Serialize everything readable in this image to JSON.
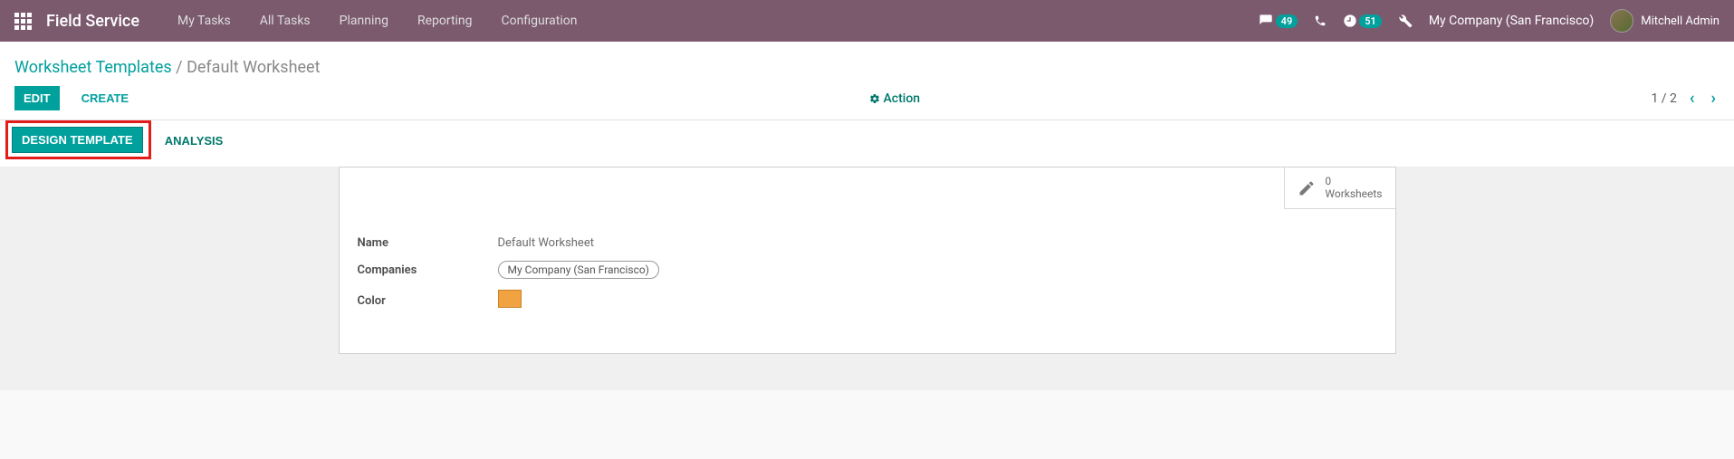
{
  "nav": {
    "brand": "Field Service",
    "items": [
      "My Tasks",
      "All Tasks",
      "Planning",
      "Reporting",
      "Configuration"
    ],
    "messages_badge": "49",
    "activities_badge": "51",
    "company": "My Company (San Francisco)",
    "user": "Mitchell Admin"
  },
  "breadcrumb": {
    "parent": "Worksheet Templates",
    "sep": "/",
    "current": "Default Worksheet"
  },
  "buttons": {
    "edit": "Edit",
    "create": "Create",
    "action": "Action",
    "design_template": "Design Template",
    "analysis": "Analysis"
  },
  "pager": {
    "text": "1 / 2"
  },
  "stat": {
    "count": "0",
    "label": "Worksheets"
  },
  "form": {
    "name_label": "Name",
    "name_value": "Default Worksheet",
    "companies_label": "Companies",
    "company_tag": "My Company (San Francisco)",
    "color_label": "Color",
    "color_hex": "#f2a341"
  }
}
